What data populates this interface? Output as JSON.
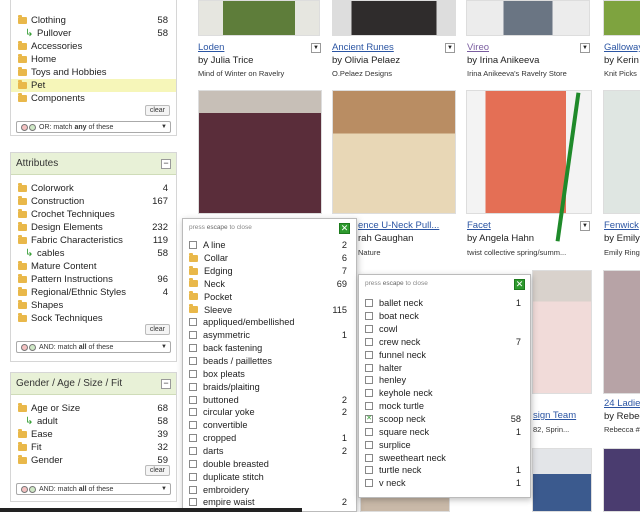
{
  "category_panel": {
    "rows": [
      {
        "label": "Clothing",
        "count": "58",
        "kind": "folder"
      },
      {
        "label": "Pullover",
        "count": "58",
        "kind": "sub"
      },
      {
        "label": "Accessories",
        "count": "",
        "kind": "folder"
      },
      {
        "label": "Home",
        "count": "",
        "kind": "folder"
      },
      {
        "label": "Toys and Hobbies",
        "count": "",
        "kind": "folder"
      },
      {
        "label": "Pet",
        "count": "",
        "kind": "folder",
        "highlight": true
      },
      {
        "label": "Components",
        "count": "",
        "kind": "folder"
      }
    ],
    "clear": "clear",
    "match_prefix": "OR: match ",
    "match_word": "any",
    "match_suffix": " of these"
  },
  "attributes_panel": {
    "title": "Attributes",
    "collapse": "−",
    "rows": [
      {
        "label": "Colorwork",
        "count": "4",
        "kind": "folder"
      },
      {
        "label": "Construction",
        "count": "167",
        "kind": "folder"
      },
      {
        "label": "Crochet Techniques",
        "count": "",
        "kind": "folder"
      },
      {
        "label": "Design Elements",
        "count": "232",
        "kind": "folder"
      },
      {
        "label": "Fabric Characteristics",
        "count": "119",
        "kind": "folder"
      },
      {
        "label": "cables",
        "count": "58",
        "kind": "sub"
      },
      {
        "label": "Mature Content",
        "count": "",
        "kind": "folder"
      },
      {
        "label": "Pattern Instructions",
        "count": "96",
        "kind": "folder"
      },
      {
        "label": "Regional/Ethnic Styles",
        "count": "4",
        "kind": "folder"
      },
      {
        "label": "Shapes",
        "count": "",
        "kind": "folder"
      },
      {
        "label": "Sock Techniques",
        "count": "",
        "kind": "folder"
      }
    ],
    "clear": "clear",
    "match_prefix": "AND: match ",
    "match_word": "all",
    "match_suffix": " of these"
  },
  "gender_panel": {
    "title": "Gender / Age / Size / Fit",
    "collapse": "−",
    "rows": [
      {
        "label": "Age or Size",
        "count": "68",
        "kind": "folder"
      },
      {
        "label": "adult",
        "count": "58",
        "kind": "sub"
      },
      {
        "label": "Ease",
        "count": "39",
        "kind": "folder"
      },
      {
        "label": "Fit",
        "count": "32",
        "kind": "folder"
      },
      {
        "label": "Gender",
        "count": "59",
        "kind": "folder"
      }
    ],
    "clear": "clear",
    "match_prefix": "AND: match ",
    "match_word": "all",
    "match_suffix": " of these"
  },
  "products": [
    {
      "title": "Loden",
      "by": "by Julia Trice",
      "src": "Mind of Winter on Ravelry",
      "visited": false
    },
    {
      "title": "Ancient Runes",
      "by": "by Olivia Pelaez",
      "src": "O.Pelaez Designs",
      "visited": false
    },
    {
      "title": "Vireo",
      "by": "by Irina Anikeeva",
      "src": "Irina Anikeeva's Ravelry Store",
      "visited": true
    },
    {
      "title": "Galloway",
      "by": "by Kerin",
      "src": "Knit Picks",
      "visited": false
    },
    {
      "title": "ence U-Neck Pull...",
      "by": "rah Gaughan",
      "src": "Nature",
      "visited": false
    },
    {
      "title": "Facet",
      "by": "by Angela Hahn",
      "src": "twist collective spring/summ...",
      "visited": false
    },
    {
      "title": "Fenwick",
      "by": "by Emily",
      "src": "Emily Ring",
      "visited": false
    },
    {
      "title": "sign Team",
      "by": "82, Sprin...",
      "src": "",
      "visited": false
    },
    {
      "title": "24 Ladie",
      "by": "by Rebec",
      "src": "Rebecca #",
      "visited": false
    }
  ],
  "popup_design": {
    "hint_prefix": "press ",
    "hint_key": "escape",
    "hint_suffix": " to close",
    "close": "✕",
    "items": [
      {
        "label": "A line",
        "count": "2",
        "kind": "check"
      },
      {
        "label": "Collar",
        "count": "6",
        "kind": "folder"
      },
      {
        "label": "Edging",
        "count": "7",
        "kind": "folder"
      },
      {
        "label": "Neck",
        "count": "69",
        "kind": "folder"
      },
      {
        "label": "Pocket",
        "count": "",
        "kind": "folder"
      },
      {
        "label": "Sleeve",
        "count": "115",
        "kind": "folder"
      },
      {
        "label": "appliqued/embellished",
        "count": "",
        "kind": "check"
      },
      {
        "label": "asymmetric",
        "count": "1",
        "kind": "check"
      },
      {
        "label": "back fastening",
        "count": "",
        "kind": "check"
      },
      {
        "label": "beads / paillettes",
        "count": "",
        "kind": "check"
      },
      {
        "label": "box pleats",
        "count": "",
        "kind": "check"
      },
      {
        "label": "braids/plaiting",
        "count": "",
        "kind": "check"
      },
      {
        "label": "buttoned",
        "count": "2",
        "kind": "check"
      },
      {
        "label": "circular yoke",
        "count": "2",
        "kind": "check"
      },
      {
        "label": "convertible",
        "count": "",
        "kind": "check"
      },
      {
        "label": "cropped",
        "count": "1",
        "kind": "check"
      },
      {
        "label": "darts",
        "count": "2",
        "kind": "check"
      },
      {
        "label": "double breasted",
        "count": "",
        "kind": "check"
      },
      {
        "label": "duplicate stitch",
        "count": "",
        "kind": "check"
      },
      {
        "label": "embroidery",
        "count": "",
        "kind": "check"
      },
      {
        "label": "empire waist",
        "count": "2",
        "kind": "check"
      }
    ]
  },
  "popup_neck": {
    "hint_prefix": "press ",
    "hint_key": "escape",
    "hint_suffix": " to close",
    "close": "✕",
    "items": [
      {
        "label": "ballet neck",
        "count": "1",
        "checked": false
      },
      {
        "label": "boat neck",
        "count": "",
        "checked": false
      },
      {
        "label": "cowl",
        "count": "",
        "checked": false
      },
      {
        "label": "crew neck",
        "count": "7",
        "checked": false
      },
      {
        "label": "funnel neck",
        "count": "",
        "checked": false
      },
      {
        "label": "halter",
        "count": "",
        "checked": false
      },
      {
        "label": "henley",
        "count": "",
        "checked": false
      },
      {
        "label": "keyhole neck",
        "count": "",
        "checked": false
      },
      {
        "label": "mock turtle",
        "count": "",
        "checked": false
      },
      {
        "label": "scoop neck",
        "count": "58",
        "checked": true
      },
      {
        "label": "square neck",
        "count": "1",
        "checked": false
      },
      {
        "label": "surplice",
        "count": "",
        "checked": false
      },
      {
        "label": "sweetheart neck",
        "count": "",
        "checked": false
      },
      {
        "label": "turtle neck",
        "count": "1",
        "checked": false
      },
      {
        "label": "v neck",
        "count": "1",
        "checked": false
      }
    ]
  },
  "colors": {
    "accent_green": "#2e9a2e",
    "panel_header": "#e8f1d7",
    "link": "#2b55a3",
    "highlight": "#f6f6b9"
  }
}
